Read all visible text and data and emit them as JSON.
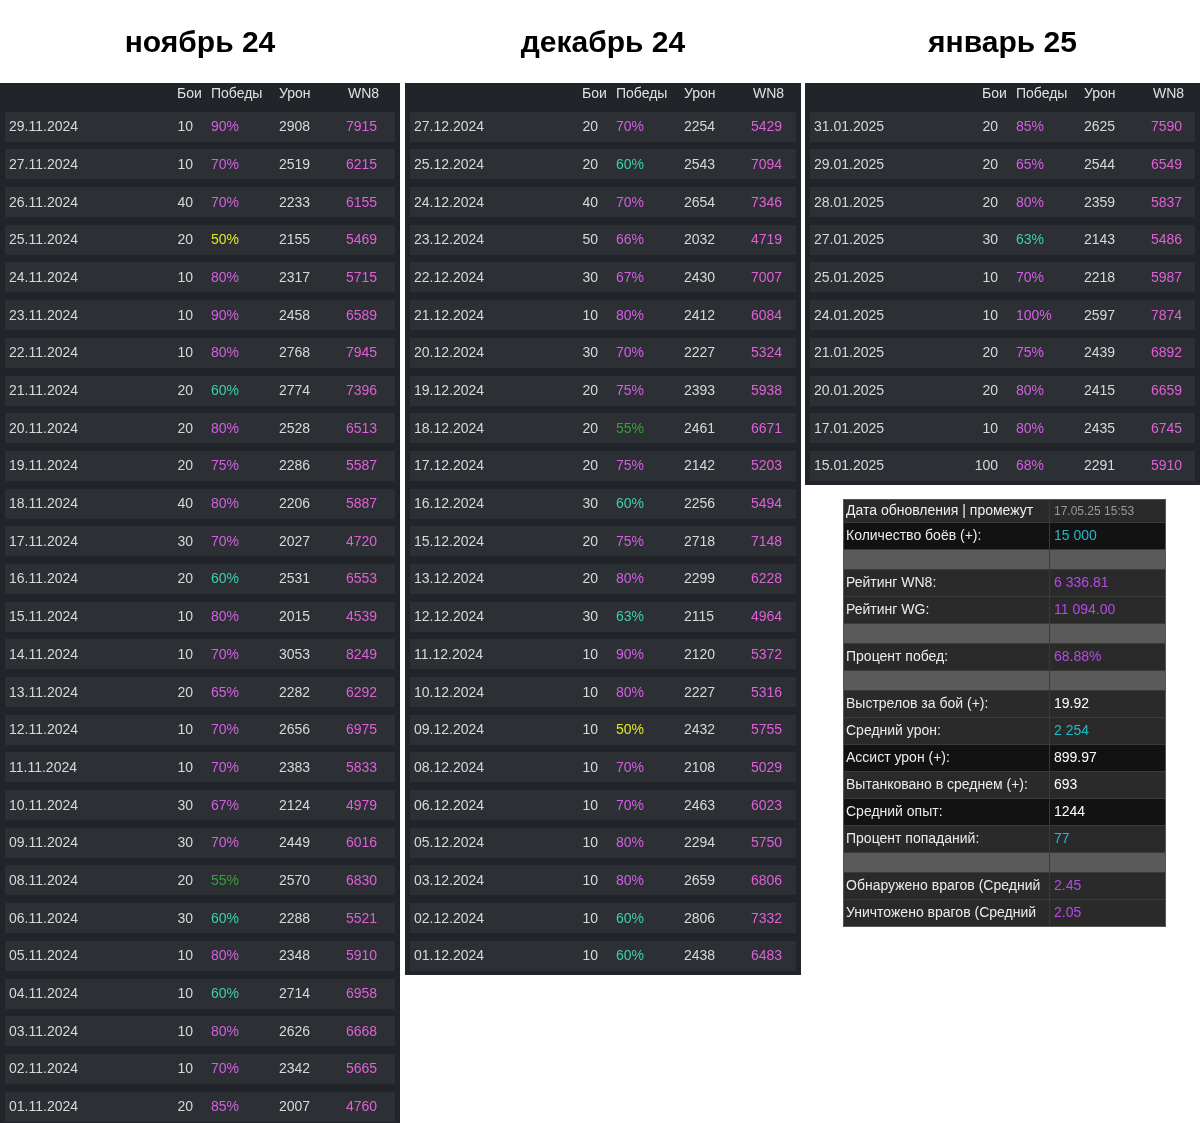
{
  "months": [
    {
      "title": "ноябрь 24",
      "columns": [
        "Бои",
        "Победы",
        "Урон",
        "WN8"
      ],
      "rows": [
        {
          "date": "29.11.2024",
          "battles": "10",
          "wins": "90%",
          "color": "#d65ee6",
          "damage": "2908",
          "wn8": "7915"
        },
        {
          "date": "27.11.2024",
          "battles": "10",
          "wins": "70%",
          "color": "#d65ee6",
          "damage": "2519",
          "wn8": "6215"
        },
        {
          "date": "26.11.2024",
          "battles": "40",
          "wins": "70%",
          "color": "#d65ee6",
          "damage": "2233",
          "wn8": "6155"
        },
        {
          "date": "25.11.2024",
          "battles": "20",
          "wins": "50%",
          "color": "#e6e61e",
          "damage": "2155",
          "wn8": "5469"
        },
        {
          "date": "24.11.2024",
          "battles": "10",
          "wins": "80%",
          "color": "#d65ee6",
          "damage": "2317",
          "wn8": "5715"
        },
        {
          "date": "23.11.2024",
          "battles": "10",
          "wins": "90%",
          "color": "#d65ee6",
          "damage": "2458",
          "wn8": "6589"
        },
        {
          "date": "22.11.2024",
          "battles": "10",
          "wins": "80%",
          "color": "#d65ee6",
          "damage": "2768",
          "wn8": "7945"
        },
        {
          "date": "21.11.2024",
          "battles": "20",
          "wins": "60%",
          "color": "#3ccfb0",
          "damage": "2774",
          "wn8": "7396"
        },
        {
          "date": "20.11.2024",
          "battles": "20",
          "wins": "80%",
          "color": "#d65ee6",
          "damage": "2528",
          "wn8": "6513"
        },
        {
          "date": "19.11.2024",
          "battles": "20",
          "wins": "75%",
          "color": "#d65ee6",
          "damage": "2286",
          "wn8": "5587"
        },
        {
          "date": "18.11.2024",
          "battles": "40",
          "wins": "80%",
          "color": "#d65ee6",
          "damage": "2206",
          "wn8": "5887"
        },
        {
          "date": "17.11.2024",
          "battles": "30",
          "wins": "70%",
          "color": "#d65ee6",
          "damage": "2027",
          "wn8": "4720"
        },
        {
          "date": "16.11.2024",
          "battles": "20",
          "wins": "60%",
          "color": "#3ccfb0",
          "damage": "2531",
          "wn8": "6553"
        },
        {
          "date": "15.11.2024",
          "battles": "10",
          "wins": "80%",
          "color": "#d65ee6",
          "damage": "2015",
          "wn8": "4539"
        },
        {
          "date": "14.11.2024",
          "battles": "10",
          "wins": "70%",
          "color": "#d65ee6",
          "damage": "3053",
          "wn8": "8249"
        },
        {
          "date": "13.11.2024",
          "battles": "20",
          "wins": "65%",
          "color": "#d65ee6",
          "damage": "2282",
          "wn8": "6292"
        },
        {
          "date": "12.11.2024",
          "battles": "10",
          "wins": "70%",
          "color": "#d65ee6",
          "damage": "2656",
          "wn8": "6975"
        },
        {
          "date": "11.11.2024",
          "battles": "10",
          "wins": "70%",
          "color": "#d65ee6",
          "damage": "2383",
          "wn8": "5833"
        },
        {
          "date": "10.11.2024",
          "battles": "30",
          "wins": "67%",
          "color": "#d65ee6",
          "damage": "2124",
          "wn8": "4979"
        },
        {
          "date": "09.11.2024",
          "battles": "30",
          "wins": "70%",
          "color": "#d65ee6",
          "damage": "2449",
          "wn8": "6016"
        },
        {
          "date": "08.11.2024",
          "battles": "20",
          "wins": "55%",
          "color": "#3c9e3c",
          "damage": "2570",
          "wn8": "6830"
        },
        {
          "date": "06.11.2024",
          "battles": "30",
          "wins": "60%",
          "color": "#3ccfb0",
          "damage": "2288",
          "wn8": "5521"
        },
        {
          "date": "05.11.2024",
          "battles": "10",
          "wins": "80%",
          "color": "#d65ee6",
          "damage": "2348",
          "wn8": "5910"
        },
        {
          "date": "04.11.2024",
          "battles": "10",
          "wins": "60%",
          "color": "#3ccfb0",
          "damage": "2714",
          "wn8": "6958"
        },
        {
          "date": "03.11.2024",
          "battles": "10",
          "wins": "80%",
          "color": "#d65ee6",
          "damage": "2626",
          "wn8": "6668"
        },
        {
          "date": "02.11.2024",
          "battles": "10",
          "wins": "70%",
          "color": "#d65ee6",
          "damage": "2342",
          "wn8": "5665"
        },
        {
          "date": "01.11.2024",
          "battles": "20",
          "wins": "85%",
          "color": "#d65ee6",
          "damage": "2007",
          "wn8": "4760"
        }
      ]
    },
    {
      "title": "декабрь 24",
      "columns": [
        "Бои",
        "Победы",
        "Урон",
        "WN8"
      ],
      "rows": [
        {
          "date": "27.12.2024",
          "battles": "20",
          "wins": "70%",
          "color": "#d65ee6",
          "damage": "2254",
          "wn8": "5429"
        },
        {
          "date": "25.12.2024",
          "battles": "20",
          "wins": "60%",
          "color": "#3ccfb0",
          "damage": "2543",
          "wn8": "7094"
        },
        {
          "date": "24.12.2024",
          "battles": "40",
          "wins": "70%",
          "color": "#d65ee6",
          "damage": "2654",
          "wn8": "7346"
        },
        {
          "date": "23.12.2024",
          "battles": "50",
          "wins": "66%",
          "color": "#d65ee6",
          "damage": "2032",
          "wn8": "4719"
        },
        {
          "date": "22.12.2024",
          "battles": "30",
          "wins": "67%",
          "color": "#d65ee6",
          "damage": "2430",
          "wn8": "7007"
        },
        {
          "date": "21.12.2024",
          "battles": "10",
          "wins": "80%",
          "color": "#d65ee6",
          "damage": "2412",
          "wn8": "6084"
        },
        {
          "date": "20.12.2024",
          "battles": "30",
          "wins": "70%",
          "color": "#d65ee6",
          "damage": "2227",
          "wn8": "5324"
        },
        {
          "date": "19.12.2024",
          "battles": "20",
          "wins": "75%",
          "color": "#d65ee6",
          "damage": "2393",
          "wn8": "5938"
        },
        {
          "date": "18.12.2024",
          "battles": "20",
          "wins": "55%",
          "color": "#3c9e3c",
          "damage": "2461",
          "wn8": "6671"
        },
        {
          "date": "17.12.2024",
          "battles": "20",
          "wins": "75%",
          "color": "#d65ee6",
          "damage": "2142",
          "wn8": "5203"
        },
        {
          "date": "16.12.2024",
          "battles": "30",
          "wins": "60%",
          "color": "#3ccfb0",
          "damage": "2256",
          "wn8": "5494"
        },
        {
          "date": "15.12.2024",
          "battles": "20",
          "wins": "75%",
          "color": "#d65ee6",
          "damage": "2718",
          "wn8": "7148"
        },
        {
          "date": "13.12.2024",
          "battles": "20",
          "wins": "80%",
          "color": "#d65ee6",
          "damage": "2299",
          "wn8": "6228"
        },
        {
          "date": "12.12.2024",
          "battles": "30",
          "wins": "63%",
          "color": "#3ccfb0",
          "damage": "2115",
          "wn8": "4964"
        },
        {
          "date": "11.12.2024",
          "battles": "10",
          "wins": "90%",
          "color": "#d65ee6",
          "damage": "2120",
          "wn8": "5372"
        },
        {
          "date": "10.12.2024",
          "battles": "10",
          "wins": "80%",
          "color": "#d65ee6",
          "damage": "2227",
          "wn8": "5316"
        },
        {
          "date": "09.12.2024",
          "battles": "10",
          "wins": "50%",
          "color": "#e6e61e",
          "damage": "2432",
          "wn8": "5755"
        },
        {
          "date": "08.12.2024",
          "battles": "10",
          "wins": "70%",
          "color": "#d65ee6",
          "damage": "2108",
          "wn8": "5029"
        },
        {
          "date": "06.12.2024",
          "battles": "10",
          "wins": "70%",
          "color": "#d65ee6",
          "damage": "2463",
          "wn8": "6023"
        },
        {
          "date": "05.12.2024",
          "battles": "10",
          "wins": "80%",
          "color": "#d65ee6",
          "damage": "2294",
          "wn8": "5750"
        },
        {
          "date": "03.12.2024",
          "battles": "10",
          "wins": "80%",
          "color": "#d65ee6",
          "damage": "2659",
          "wn8": "6806"
        },
        {
          "date": "02.12.2024",
          "battles": "10",
          "wins": "60%",
          "color": "#3ccfb0",
          "damage": "2806",
          "wn8": "7332"
        },
        {
          "date": "01.12.2024",
          "battles": "10",
          "wins": "60%",
          "color": "#3ccfb0",
          "damage": "2438",
          "wn8": "6483"
        }
      ]
    },
    {
      "title": "январь 25",
      "columns": [
        "Бои",
        "Победы",
        "Урон",
        "WN8"
      ],
      "rows": [
        {
          "date": "31.01.2025",
          "battles": "20",
          "wins": "85%",
          "color": "#d65ee6",
          "damage": "2625",
          "wn8": "7590"
        },
        {
          "date": "29.01.2025",
          "battles": "20",
          "wins": "65%",
          "color": "#d65ee6",
          "damage": "2544",
          "wn8": "6549"
        },
        {
          "date": "28.01.2025",
          "battles": "20",
          "wins": "80%",
          "color": "#d65ee6",
          "damage": "2359",
          "wn8": "5837"
        },
        {
          "date": "27.01.2025",
          "battles": "30",
          "wins": "63%",
          "color": "#3ccfb0",
          "damage": "2143",
          "wn8": "5486"
        },
        {
          "date": "25.01.2025",
          "battles": "10",
          "wins": "70%",
          "color": "#d65ee6",
          "damage": "2218",
          "wn8": "5987"
        },
        {
          "date": "24.01.2025",
          "battles": "10",
          "wins": "100%",
          "color": "#d65ee6",
          "damage": "2597",
          "wn8": "7874"
        },
        {
          "date": "21.01.2025",
          "battles": "20",
          "wins": "75%",
          "color": "#d65ee6",
          "damage": "2439",
          "wn8": "6892"
        },
        {
          "date": "20.01.2025",
          "battles": "20",
          "wins": "80%",
          "color": "#d65ee6",
          "damage": "2415",
          "wn8": "6659"
        },
        {
          "date": "17.01.2025",
          "battles": "10",
          "wins": "80%",
          "color": "#d65ee6",
          "damage": "2435",
          "wn8": "6745"
        },
        {
          "date": "15.01.2025",
          "battles": "100",
          "wins": "68%",
          "color": "#d65ee6",
          "damage": "2291",
          "wn8": "5910"
        }
      ]
    }
  ],
  "summary": {
    "rows": [
      {
        "kind": "header",
        "label": "Дата обновления | промежут",
        "value": "17.05.25 15:53"
      },
      {
        "kind": "row",
        "dark": true,
        "label": "Количество боёв (+):",
        "value": "15 000",
        "color": "#22b8c8"
      },
      {
        "kind": "spacer"
      },
      {
        "kind": "row",
        "dark": false,
        "label": "Рейтинг WN8:",
        "value": "6 336.81",
        "color": "#b64ae6"
      },
      {
        "kind": "row",
        "dark": false,
        "label": "Рейтинг WG:",
        "value": "11 094.00",
        "color": "#b64ae6"
      },
      {
        "kind": "spacer"
      },
      {
        "kind": "row",
        "dark": false,
        "label": "Процент побед:",
        "value": "68.88%",
        "color": "#b64ae6"
      },
      {
        "kind": "spacer"
      },
      {
        "kind": "row",
        "dark": false,
        "label": "Выстрелов за бой (+):",
        "value": "19.92",
        "color": "#ffffff"
      },
      {
        "kind": "row",
        "dark": false,
        "label": "Средний урон:",
        "value": "2 254",
        "color": "#22b8c8"
      },
      {
        "kind": "row",
        "dark": true,
        "label": "Ассист урон (+):",
        "value": "899.97",
        "color": "#ffffff"
      },
      {
        "kind": "row",
        "dark": false,
        "label": "Вытанковано в среднем (+):",
        "value": "693",
        "color": "#ffffff"
      },
      {
        "kind": "row",
        "dark": true,
        "label": "Средний опыт:",
        "value": "1244",
        "color": "#ffffff"
      },
      {
        "kind": "row",
        "dark": false,
        "label": "Процент попаданий:",
        "value": "77",
        "color": "#22b8c8"
      },
      {
        "kind": "spacer"
      },
      {
        "kind": "row",
        "dark": false,
        "label": "Обнаружено врагов (Средний",
        "value": "2.45",
        "color": "#b64ae6"
      },
      {
        "kind": "row",
        "dark": false,
        "label": "Уничтожено врагов (Средний",
        "value": "2.05",
        "color": "#b64ae6"
      }
    ]
  }
}
